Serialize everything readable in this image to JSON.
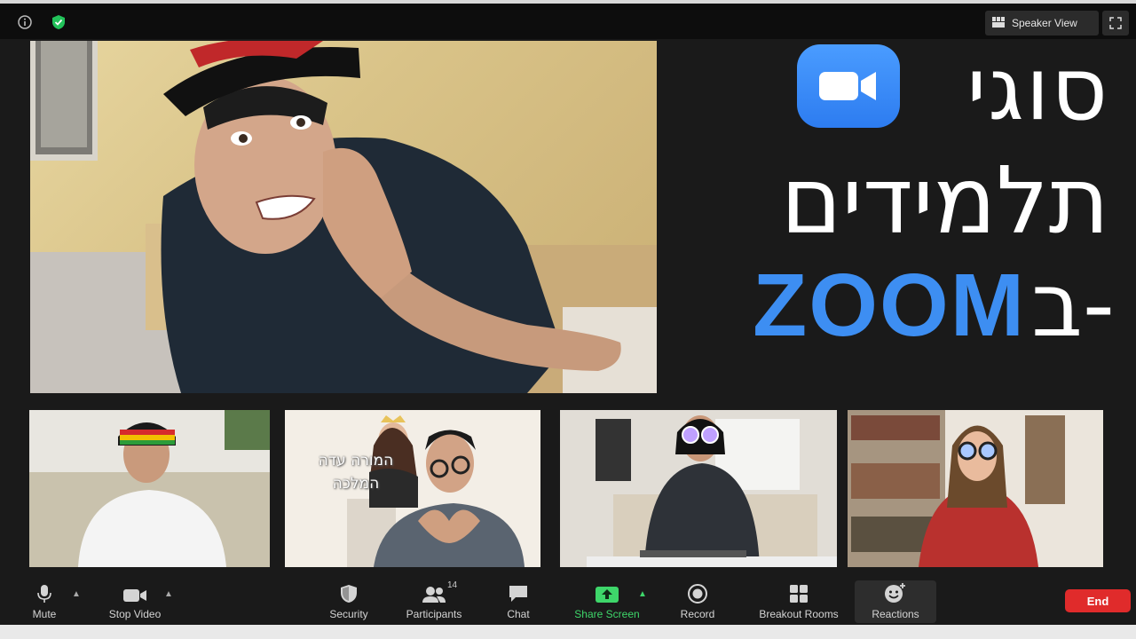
{
  "topbar": {
    "speaker_view_label": "Speaker View"
  },
  "title": {
    "line1": "סוגי",
    "line2": "תלמידים",
    "prefix": "ב-",
    "zoom": "ZOOM"
  },
  "thumbnails": {
    "overlay_line1": "המורה עדה",
    "overlay_line2": "המלכה"
  },
  "toolbar": {
    "mute": "Mute",
    "stop_video": "Stop Video",
    "security": "Security",
    "participants": "Participants",
    "participants_count": "14",
    "chat": "Chat",
    "share_screen": "Share Screen",
    "record": "Record",
    "breakout_rooms": "Breakout Rooms",
    "reactions": "Reactions",
    "end": "End"
  },
  "colors": {
    "zoom_blue": "#3d8ef2",
    "share_green": "#3ed66a",
    "end_red": "#e02b2b",
    "security_green": "#22c25a"
  }
}
